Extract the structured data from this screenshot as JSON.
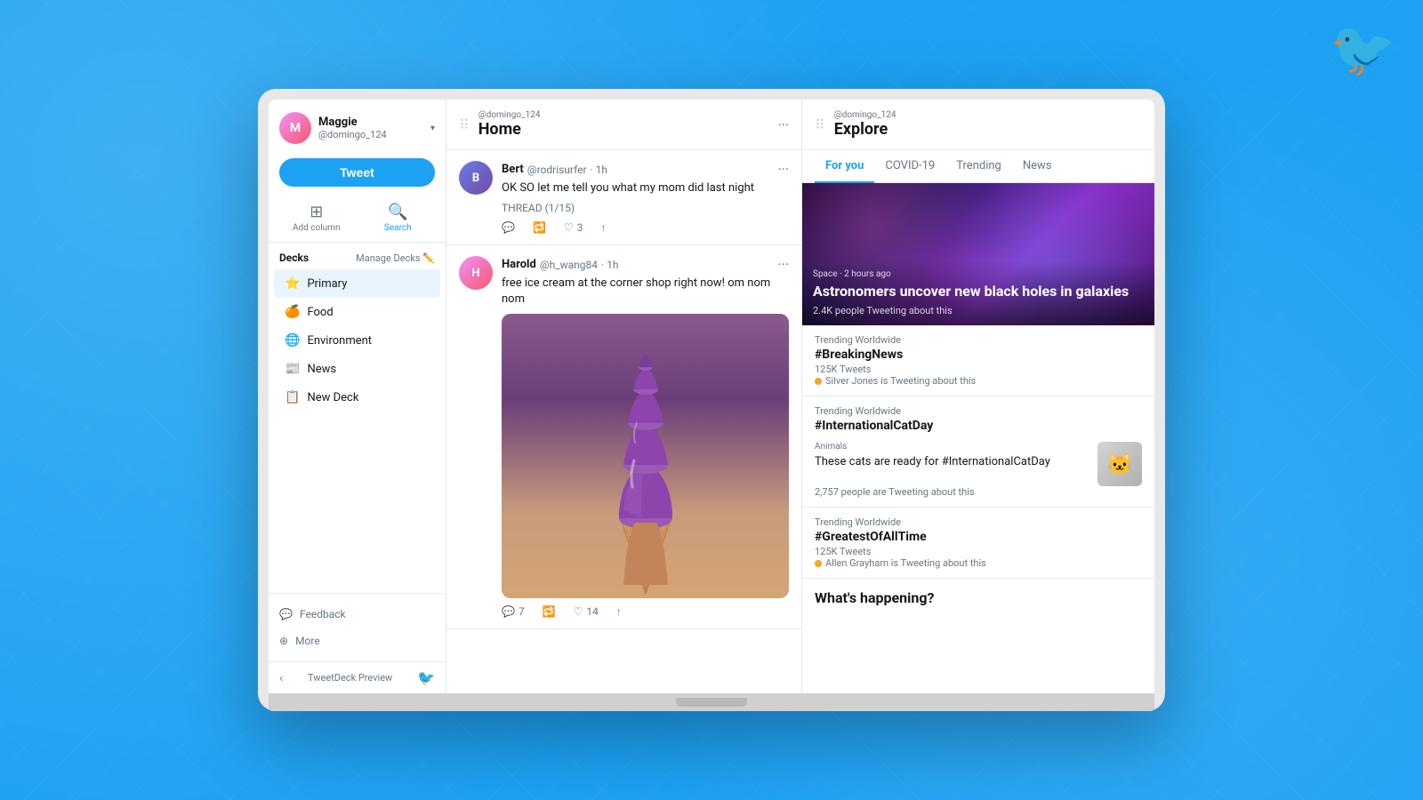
{
  "background": {
    "color": "#1da1f2"
  },
  "twitter_logo": "🐦",
  "laptop": {
    "visible": true
  },
  "sidebar": {
    "user": {
      "name": "Maggie",
      "handle": "@domingo_124",
      "avatar_initials": "M"
    },
    "tweet_button": "Tweet",
    "nav": {
      "add_column": "Add column",
      "search": "Search"
    },
    "decks_title": "Decks",
    "manage_decks": "Manage Decks",
    "deck_items": [
      {
        "id": "primary",
        "label": "Primary",
        "icon": "⭐",
        "active": true
      },
      {
        "id": "food",
        "label": "Food",
        "icon": "🍊",
        "active": false
      },
      {
        "id": "environment",
        "label": "Environment",
        "icon": "🌐",
        "active": false
      },
      {
        "id": "news",
        "label": "News",
        "icon": "📰",
        "active": false
      },
      {
        "id": "new-deck",
        "label": "New Deck",
        "icon": "📋",
        "active": false
      }
    ],
    "footer": {
      "feedback": "Feedback",
      "more": "More"
    },
    "tweetdeck_label": "TweetDeck Preview"
  },
  "home_column": {
    "username": "@domingo_124",
    "title": "Home",
    "tweets": [
      {
        "id": "bert",
        "name": "Bert",
        "handle": "@rodrisurfer",
        "time": "1h",
        "text": "OK SO let me tell you what my mom did last night",
        "thread": "THREAD (1/15)",
        "replies": 0,
        "retweets": 0,
        "likes": 3,
        "has_image": false,
        "avatar_initials": "B"
      },
      {
        "id": "harold",
        "name": "Harold",
        "handle": "@h_wang84",
        "time": "1h",
        "text": "free ice cream at the corner shop right now! om nom nom",
        "thread": "",
        "replies": 7,
        "retweets": 0,
        "likes": 14,
        "has_image": true,
        "avatar_initials": "H"
      }
    ]
  },
  "explore_column": {
    "username": "@domingo_124",
    "title": "Explore",
    "tabs": [
      {
        "id": "for-you",
        "label": "For you",
        "active": true
      },
      {
        "id": "covid-19",
        "label": "COVID-19",
        "active": false
      },
      {
        "id": "trending",
        "label": "Trending",
        "active": false
      },
      {
        "id": "news",
        "label": "News",
        "active": false
      }
    ],
    "hero": {
      "category": "Space · 2 hours ago",
      "title": "Astronomers uncover new black holes in galaxies",
      "count": "2.4K people Tweeting about this"
    },
    "trending_items": [
      {
        "id": "breaking-news",
        "label": "Trending Worldwide",
        "tag": "#BreakingNews",
        "count": "125K Tweets",
        "user_text": "Silver Jones is Tweeting about this",
        "dot_color": "orange"
      },
      {
        "id": "cat-day",
        "label": "Trending Worldwide",
        "tag": "#InternationalCatDay",
        "count": "",
        "has_card": true,
        "card": {
          "category": "Animals",
          "text": "These cats are ready for #InternationalCatDay",
          "count": "2,757 people are Tweeting about this",
          "image_emoji": "🐱"
        }
      },
      {
        "id": "greatest-of-all-time",
        "label": "Trending Worldwide",
        "tag": "#GreatestOfAllTime",
        "count": "125K Tweets",
        "user_text": "Allen Grayham is Tweeting about this",
        "dot_color": "orange"
      }
    ],
    "whats_happening": "What's happening?"
  }
}
